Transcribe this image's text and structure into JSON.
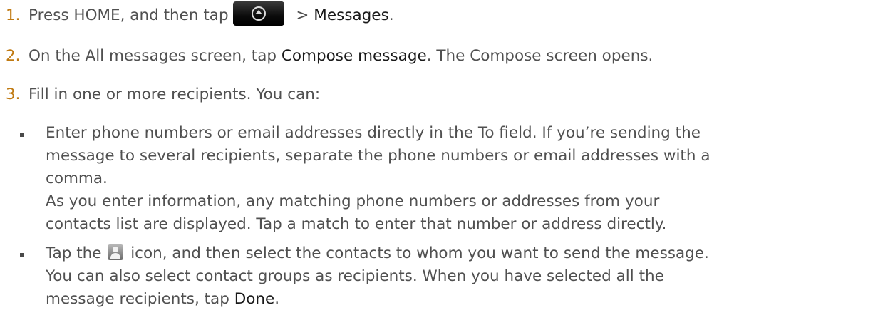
{
  "steps": [
    {
      "number": "1.",
      "text_before": "Press HOME, and then tap",
      "button_icon": "home-launcher-arrow-icon",
      "text_after": " > ",
      "ui_label": "Messages",
      "text_end": "."
    },
    {
      "number": "2.",
      "text_before": "On the All messages screen, tap ",
      "ui_label": "Compose message",
      "text_after": ". The Compose screen opens."
    },
    {
      "number": "3.",
      "text": "Fill in one or more recipients. You can:"
    }
  ],
  "bullets": [
    {
      "lines": [
        "Enter phone numbers or email addresses directly in the To field. If you’re sending the",
        "message to several recipients, separate the phone numbers or email addresses with a",
        "comma.",
        "As you enter information, any matching phone numbers or addresses from your",
        "contacts list are displayed. Tap a match to enter that number or address directly."
      ]
    },
    {
      "line1_before": "Tap the ",
      "icon": "contact-person-icon",
      "line1_after": " icon, and then select the contacts to whom you want to send the message.",
      "line2": "You can also select contact groups as recipients. When you have selected all the",
      "line3_before": "message recipients, tap ",
      "ui_label": "Done",
      "line3_after": "."
    }
  ],
  "colors": {
    "step_number": "#c07a12",
    "body_text": "#505050",
    "ui_label": "#1a1a1a"
  }
}
